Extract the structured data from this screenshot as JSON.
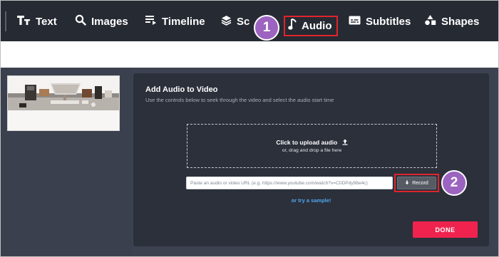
{
  "nav": {
    "items": [
      {
        "label": "Text",
        "icon": "text-size-icon"
      },
      {
        "label": "Images",
        "icon": "search-icon"
      },
      {
        "label": "Timeline",
        "icon": "timeline-icon"
      },
      {
        "label": "Sce",
        "icon": "layers-icon"
      },
      {
        "label": "Audio",
        "icon": "music-note-icon"
      },
      {
        "label": "Subtitles",
        "icon": "subtitles-icon"
      },
      {
        "label": "Shapes",
        "icon": "shapes-icon"
      }
    ]
  },
  "callouts": {
    "one": "1",
    "two": "2"
  },
  "panel": {
    "title": "Add Audio to Video",
    "description": "Use the controls below to seek through the video and select the audio start time"
  },
  "upload": {
    "main_label": "Click to upload audio",
    "sub_label": "or, drag and drop a file here",
    "icon": "upload-arrow-icon"
  },
  "url_input": {
    "placeholder": "Paste an audio or video URL (e.g. https://www.youtube.com/watch?v=C0DPdy98e4c)",
    "value": ""
  },
  "record": {
    "label": "Record",
    "icon": "download-arrow-icon"
  },
  "sample_link": "or try a sample!",
  "done_button": "DONE",
  "colors": {
    "toolbar_bg": "#262a33",
    "editor_bg": "#3c4250",
    "panel_bg": "#2b303b",
    "highlight_red": "#e0242b",
    "callout_purple": "#9c63c0",
    "done_pink": "#f0234f",
    "link_blue": "#4fa6ea"
  }
}
